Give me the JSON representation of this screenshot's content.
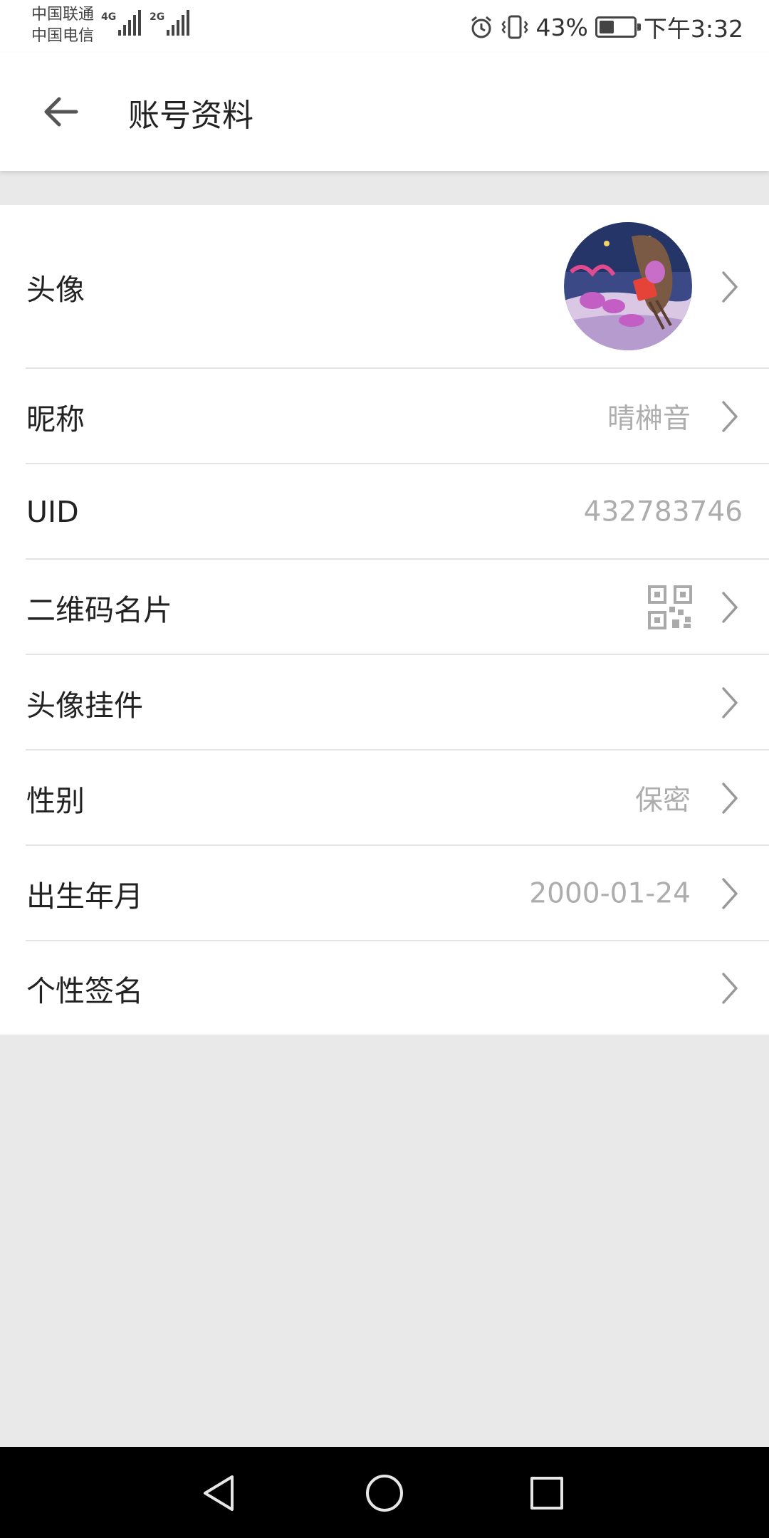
{
  "status_bar": {
    "carrier_1": "中国联通",
    "carrier_2": "中国电信",
    "network_1": "4G",
    "network_2": "2G",
    "battery_percent": "43%",
    "battery_level": 0.43,
    "time": "下午3:32",
    "icons": [
      "alarm-icon",
      "vibrate-icon",
      "battery-icon"
    ]
  },
  "header": {
    "title": "账号资料",
    "back_icon": "back-arrow-icon"
  },
  "profile": {
    "avatar": {
      "label": "头像"
    },
    "nickname": {
      "label": "昵称",
      "value": "晴榊音"
    },
    "uid": {
      "label": "UID",
      "value": "432783746"
    },
    "qr_card": {
      "label": "二维码名片",
      "icon": "qr-code-icon"
    },
    "avatar_pendant": {
      "label": "头像挂件"
    },
    "gender": {
      "label": "性别",
      "value": "保密"
    },
    "birthday": {
      "label": "出生年月",
      "value": "2000-01-24"
    },
    "signature": {
      "label": "个性签名"
    }
  },
  "nav_bar": {
    "buttons": [
      "back-triangle-icon",
      "home-circle-icon",
      "recents-square-icon"
    ]
  },
  "colors": {
    "background": "#e9e9e9",
    "surface": "#ffffff",
    "text_primary": "#222222",
    "text_secondary": "#adadad",
    "divider": "#e3e3e3"
  }
}
